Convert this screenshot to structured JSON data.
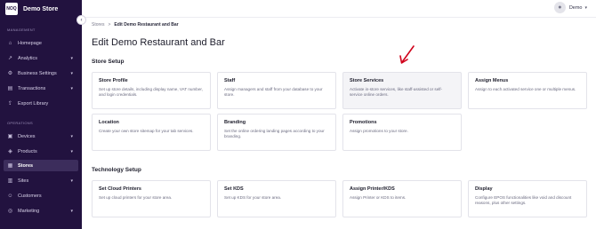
{
  "sidebar": {
    "brand_logo": "NOQ",
    "brand_name": "Demo Store",
    "management_label": "MANAGEMENT",
    "operations_label": "OPERATIONS",
    "items": [
      {
        "label": "Homepage",
        "icon": "home-icon"
      },
      {
        "label": "Analytics",
        "icon": "chart-icon"
      },
      {
        "label": "Business Settings",
        "icon": "gear-icon"
      },
      {
        "label": "Transactions",
        "icon": "transactions-icon"
      },
      {
        "label": "Export Library",
        "icon": "export-icon"
      },
      {
        "label": "Devices",
        "icon": "device-icon"
      },
      {
        "label": "Products",
        "icon": "tag-icon"
      },
      {
        "label": "Stores",
        "icon": "store-icon"
      },
      {
        "label": "Sites",
        "icon": "sites-icon"
      },
      {
        "label": "Customers",
        "icon": "customers-icon"
      },
      {
        "label": "Marketing",
        "icon": "marketing-icon"
      }
    ]
  },
  "header": {
    "user_name": "Demo"
  },
  "breadcrumb": {
    "root": "Stores",
    "separator": ">",
    "current": "Edit Demo Restaurant and Bar"
  },
  "page_title": "Edit Demo Restaurant and Bar",
  "store_setup": {
    "title": "Store Setup",
    "cards": [
      {
        "title": "Store Profile",
        "desc": "Set up store details, including display name, VAT number, and login credentials."
      },
      {
        "title": "Staff",
        "desc": "Assign managers and staff from your database to your store."
      },
      {
        "title": "Store Services",
        "desc": "Activate in-store services, like staff-assisted or self-service online orders."
      },
      {
        "title": "Assign Menus",
        "desc": "Assign to each activated service one or multiple menus."
      },
      {
        "title": "Location",
        "desc": "Create your own store sitemap for your tab services."
      },
      {
        "title": "Branding",
        "desc": "Set the online ordering landing pages according to your branding."
      },
      {
        "title": "Promotions",
        "desc": "Assign promotions to your store."
      }
    ]
  },
  "technology_setup": {
    "title": "Technology Setup",
    "cards": [
      {
        "title": "Set Cloud Printers",
        "desc": "Set up cloud printers for your store area."
      },
      {
        "title": "Set KDS",
        "desc": "Set up KDS for your store area."
      },
      {
        "title": "Assign Printer/KDS",
        "desc": "Assign Printer or KDS to items."
      },
      {
        "title": "Display",
        "desc": "Configure EPOS functionalities like void and discount reasons, plus other settings."
      }
    ]
  },
  "colors": {
    "sidebar_bg": "#22123f",
    "annotation_arrow": "#d0021b"
  }
}
